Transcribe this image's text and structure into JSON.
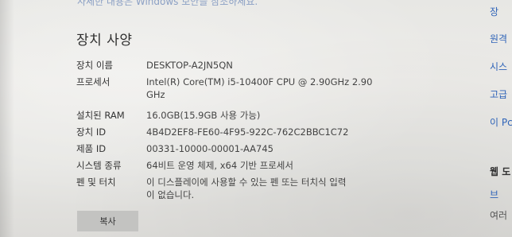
{
  "top_note": "사세한 내용은 Windows 보안을 참조하세요.",
  "section_title": "장치 사양",
  "specs": [
    {
      "label": "장치 이름",
      "value": "DESKTOP-A2JN5QN"
    },
    {
      "label": "프로세서",
      "value": "Intel(R) Core(TM) i5-10400F CPU @ 2.90GHz   2.90\nGHz"
    },
    {
      "label": "설치된 RAM",
      "value": "16.0GB(15.9GB 사용 가능)"
    },
    {
      "label": "장치 ID",
      "value": "4B4D2EF8-FE60-4F95-922C-762C2BBC1C72"
    },
    {
      "label": "제품 ID",
      "value": "00331-10000-00001-AA745"
    },
    {
      "label": "시스템 종류",
      "value": "64비트 운영 체제, x64 기반 프로세서"
    },
    {
      "label": "펜 및 터치",
      "value": "이 디스플레이에 사용할 수 있는 펜 또는 터치식 입력\n이 없습니다."
    }
  ],
  "copy_button_label": "복사",
  "right_panel": {
    "items": [
      {
        "text": "장",
        "kind": "link"
      },
      {
        "text": "원격",
        "kind": "link"
      },
      {
        "text": "시스",
        "kind": "link"
      },
      {
        "text": "고급",
        "kind": "link"
      },
      {
        "text": "이 Pc",
        "kind": "link"
      },
      {
        "text": "웹 도",
        "kind": "heading"
      },
      {
        "text": "브",
        "kind": "link"
      },
      {
        "text": "여러",
        "kind": "text"
      }
    ]
  }
}
